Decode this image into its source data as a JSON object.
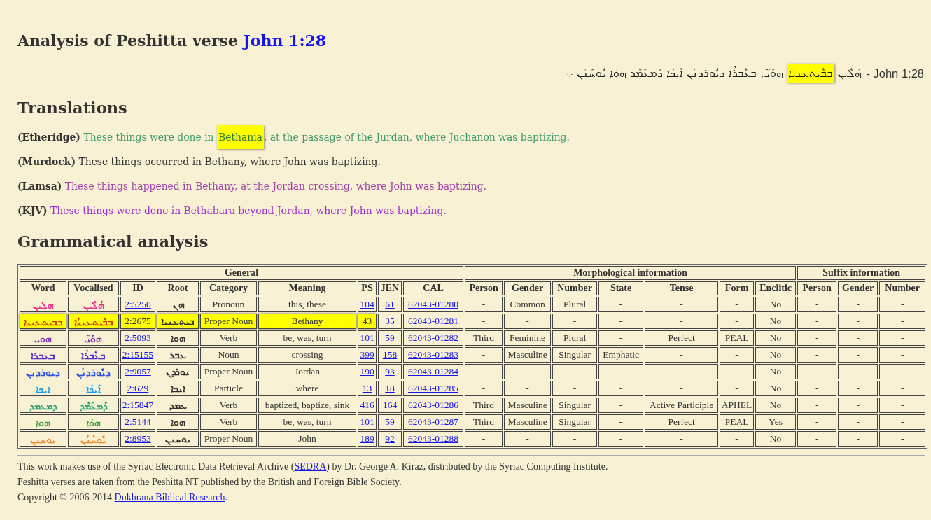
{
  "title": {
    "text": "Analysis of Peshitta verse",
    "link": "John 1:28"
  },
  "verse": {
    "segments": [
      {
        "text": "ܗܳܠܶܝܢ ",
        "highlighted": false
      },
      {
        "text": "ܒܒܶܝܬܥܢܝܳܐ",
        "highlighted": true
      },
      {
        "text": " ܗܘܰܝ̈, ܒܥܶܒܪܳܐ ܕܝܽܘܪܕܢܳܢ ܐܰܝܟܳܐ ܕܰܡܥܰܡܶܕ ܗܘܳܐ ܝܽܘܚܰܢܳܢ ܀",
        "highlighted": false
      }
    ],
    "reference": "- John 1:28"
  },
  "translations": {
    "heading": "Translations",
    "items": [
      {
        "translator": "(Etheridge)",
        "color": "#3d9b6e",
        "segments": [
          {
            "text": "These things were done in ",
            "highlighted": false
          },
          {
            "text": "Bethania",
            "highlighted": true
          },
          {
            "text": ", at the passage of the Jurdan, where Juchanon was baptizing.",
            "highlighted": false
          }
        ]
      },
      {
        "translator": "(Murdock)",
        "color": "#333333",
        "segments": [
          {
            "text": "These things occurred in Bethany, where John was baptizing.",
            "highlighted": false
          }
        ]
      },
      {
        "translator": "(Lamsa)",
        "color": "#a040a8",
        "segments": [
          {
            "text": "These things happened in Bethany, at the Jordan crossing, where John was baptizing.",
            "highlighted": false
          }
        ]
      },
      {
        "translator": "(KJV)",
        "color": "#a030d0",
        "segments": [
          {
            "text": "These things were done in Bethabara beyond Jordan, where John was baptizing.",
            "highlighted": false
          }
        ]
      }
    ]
  },
  "analysis": {
    "heading": "Grammatical analysis",
    "groups": [
      {
        "label": "General",
        "columns": [
          {
            "label": "Word",
            "kind": "colored-syriac"
          },
          {
            "label": "Vocalised",
            "kind": "colored-syriac"
          },
          {
            "label": "ID",
            "kind": "link"
          },
          {
            "label": "Root",
            "kind": "syriac"
          },
          {
            "label": "Category",
            "kind": "text"
          },
          {
            "label": "Meaning",
            "kind": "text"
          },
          {
            "label": "PS",
            "kind": "link"
          },
          {
            "label": "JEN",
            "kind": "link"
          },
          {
            "label": "CAL",
            "kind": "link"
          }
        ]
      },
      {
        "label": "Morphological information",
        "columns": [
          {
            "label": "Person",
            "kind": "text"
          },
          {
            "label": "Gender",
            "kind": "text"
          },
          {
            "label": "Number",
            "kind": "text"
          },
          {
            "label": "State",
            "kind": "text"
          },
          {
            "label": "Tense",
            "kind": "text"
          },
          {
            "label": "Form",
            "kind": "text"
          },
          {
            "label": "Enclitic",
            "kind": "text"
          }
        ]
      },
      {
        "label": "Suffix information",
        "columns": [
          {
            "label": "Person",
            "kind": "text"
          },
          {
            "label": "Gender",
            "kind": "text"
          },
          {
            "label": "Number",
            "kind": "text"
          }
        ]
      }
    ],
    "rows": [
      {
        "color": "#e8308a",
        "cells": [
          {
            "text": "ܗܠܝܢ",
            "highlighted": false
          },
          {
            "text": "ܗܳܠܶܝܢ",
            "highlighted": false
          },
          {
            "text": "2:5250",
            "highlighted": false
          },
          {
            "text": "ܗܢ",
            "highlighted": false
          },
          {
            "text": "Pronoun",
            "highlighted": false
          },
          {
            "text": "this, these",
            "highlighted": false
          },
          {
            "text": "104",
            "highlighted": false
          },
          {
            "text": "61",
            "highlighted": false
          },
          {
            "text": "62043-01280",
            "highlighted": false
          },
          {
            "text": "-",
            "highlighted": false
          },
          {
            "text": "Common",
            "highlighted": false
          },
          {
            "text": "Plural",
            "highlighted": false
          },
          {
            "text": "-",
            "highlighted": false
          },
          {
            "text": "-",
            "highlighted": false
          },
          {
            "text": "-",
            "highlighted": false
          },
          {
            "text": "No",
            "highlighted": false
          },
          {
            "text": "-",
            "highlighted": false
          },
          {
            "text": "-",
            "highlighted": false
          },
          {
            "text": "-",
            "highlighted": false
          }
        ]
      },
      {
        "color": "#c83a10",
        "cells": [
          {
            "text": "ܒܒܝܬܥܢܝܐ",
            "highlighted": true
          },
          {
            "text": "ܒܒܶܝܬܥܢܝܳܐ",
            "highlighted": true
          },
          {
            "text": "2:2675",
            "highlighted": true
          },
          {
            "text": "ܒܝܬܥܢܝܐ",
            "highlighted": true
          },
          {
            "text": "Proper Noun",
            "highlighted": true
          },
          {
            "text": "Bethany",
            "highlighted": true
          },
          {
            "text": "43",
            "highlighted": true
          },
          {
            "text": "35",
            "highlighted": false
          },
          {
            "text": "62043-01281",
            "highlighted": false
          },
          {
            "text": "-",
            "highlighted": false
          },
          {
            "text": "-",
            "highlighted": false
          },
          {
            "text": "-",
            "highlighted": false
          },
          {
            "text": "-",
            "highlighted": false
          },
          {
            "text": "-",
            "highlighted": false
          },
          {
            "text": "-",
            "highlighted": false
          },
          {
            "text": "No",
            "highlighted": false
          },
          {
            "text": "-",
            "highlighted": false
          },
          {
            "text": "-",
            "highlighted": false
          },
          {
            "text": "-",
            "highlighted": false
          }
        ]
      },
      {
        "color": "#7a30a8",
        "cells": [
          {
            "text": "ܗܘܝ",
            "highlighted": false
          },
          {
            "text": "ܗܘܰܝ̈",
            "highlighted": false
          },
          {
            "text": "2:5093",
            "highlighted": false
          },
          {
            "text": "ܗܘܐ",
            "highlighted": false
          },
          {
            "text": "Verb",
            "highlighted": false
          },
          {
            "text": "be, was, turn",
            "highlighted": false
          },
          {
            "text": "101",
            "highlighted": false
          },
          {
            "text": "59",
            "highlighted": false
          },
          {
            "text": "62043-01282",
            "highlighted": false
          },
          {
            "text": "Third",
            "highlighted": false
          },
          {
            "text": "Feminine",
            "highlighted": false
          },
          {
            "text": "Plural",
            "highlighted": false
          },
          {
            "text": "-",
            "highlighted": false
          },
          {
            "text": "Perfect",
            "highlighted": false
          },
          {
            "text": "PEAL",
            "highlighted": false
          },
          {
            "text": "No",
            "highlighted": false
          },
          {
            "text": "-",
            "highlighted": false
          },
          {
            "text": "-",
            "highlighted": false
          },
          {
            "text": "-",
            "highlighted": false
          }
        ]
      },
      {
        "color": "#5a30c8",
        "cells": [
          {
            "text": "ܒܥܒܪܐ",
            "highlighted": false
          },
          {
            "text": "ܒܥܶܒܪܳܐ",
            "highlighted": false
          },
          {
            "text": "2:15155",
            "highlighted": false
          },
          {
            "text": "ܥܒܪ",
            "highlighted": false
          },
          {
            "text": "Noun",
            "highlighted": false
          },
          {
            "text": "crossing",
            "highlighted": false
          },
          {
            "text": "399",
            "highlighted": false
          },
          {
            "text": "158",
            "highlighted": false
          },
          {
            "text": "62043-01283",
            "highlighted": false
          },
          {
            "text": "-",
            "highlighted": false
          },
          {
            "text": "Masculine",
            "highlighted": false
          },
          {
            "text": "Singular",
            "highlighted": false
          },
          {
            "text": "Emphatic",
            "highlighted": false
          },
          {
            "text": "-",
            "highlighted": false
          },
          {
            "text": "-",
            "highlighted": false
          },
          {
            "text": "No",
            "highlighted": false
          },
          {
            "text": "-",
            "highlighted": false
          },
          {
            "text": "-",
            "highlighted": false
          },
          {
            "text": "-",
            "highlighted": false
          }
        ]
      },
      {
        "color": "#2a50e0",
        "cells": [
          {
            "text": "ܕܝܘܪܕܢܢ",
            "highlighted": false
          },
          {
            "text": "ܕܝܽܘܪܕܢܳܢ",
            "highlighted": false
          },
          {
            "text": "2:9057",
            "highlighted": false
          },
          {
            "text": "ܝܘܪܕܢ",
            "highlighted": false
          },
          {
            "text": "Proper Noun",
            "highlighted": false
          },
          {
            "text": "Jordan",
            "highlighted": false
          },
          {
            "text": "190",
            "highlighted": false
          },
          {
            "text": "93",
            "highlighted": false
          },
          {
            "text": "62043-01284",
            "highlighted": false
          },
          {
            "text": "-",
            "highlighted": false
          },
          {
            "text": "-",
            "highlighted": false
          },
          {
            "text": "-",
            "highlighted": false
          },
          {
            "text": "-",
            "highlighted": false
          },
          {
            "text": "-",
            "highlighted": false
          },
          {
            "text": "-",
            "highlighted": false
          },
          {
            "text": "No",
            "highlighted": false
          },
          {
            "text": "-",
            "highlighted": false
          },
          {
            "text": "-",
            "highlighted": false
          },
          {
            "text": "-",
            "highlighted": false
          }
        ]
      },
      {
        "color": "#18a0f0",
        "cells": [
          {
            "text": "ܐܝܟܐ",
            "highlighted": false
          },
          {
            "text": "ܐܰܝܟܳܐ",
            "highlighted": false
          },
          {
            "text": "2:629",
            "highlighted": false
          },
          {
            "text": "ܐܝܟܐ",
            "highlighted": false
          },
          {
            "text": "Particle",
            "highlighted": false
          },
          {
            "text": "where",
            "highlighted": false
          },
          {
            "text": "13",
            "highlighted": false
          },
          {
            "text": "18",
            "highlighted": false
          },
          {
            "text": "62043-01285",
            "highlighted": false
          },
          {
            "text": "-",
            "highlighted": false
          },
          {
            "text": "-",
            "highlighted": false
          },
          {
            "text": "-",
            "highlighted": false
          },
          {
            "text": "-",
            "highlighted": false
          },
          {
            "text": "-",
            "highlighted": false
          },
          {
            "text": "-",
            "highlighted": false
          },
          {
            "text": "No",
            "highlighted": false
          },
          {
            "text": "-",
            "highlighted": false
          },
          {
            "text": "-",
            "highlighted": false
          },
          {
            "text": "-",
            "highlighted": false
          }
        ]
      },
      {
        "color": "#20a070",
        "cells": [
          {
            "text": "ܕܡܥܡܕ",
            "highlighted": false
          },
          {
            "text": "ܕܰܡܥܰܡܶܕ",
            "highlighted": false
          },
          {
            "text": "2:15847",
            "highlighted": false
          },
          {
            "text": "ܥܡܕ",
            "highlighted": false
          },
          {
            "text": "Verb",
            "highlighted": false
          },
          {
            "text": "baptized, baptize, sink",
            "highlighted": false
          },
          {
            "text": "416",
            "highlighted": false
          },
          {
            "text": "164",
            "highlighted": false
          },
          {
            "text": "62043-01286",
            "highlighted": false
          },
          {
            "text": "Third",
            "highlighted": false
          },
          {
            "text": "Masculine",
            "highlighted": false
          },
          {
            "text": "Singular",
            "highlighted": false
          },
          {
            "text": "-",
            "highlighted": false
          },
          {
            "text": "Active Participle",
            "highlighted": false
          },
          {
            "text": "APHEL",
            "highlighted": false
          },
          {
            "text": "No",
            "highlighted": false
          },
          {
            "text": "-",
            "highlighted": false
          },
          {
            "text": "-",
            "highlighted": false
          },
          {
            "text": "-",
            "highlighted": false
          }
        ]
      },
      {
        "color": "#40a040",
        "cells": [
          {
            "text": "ܗܘܐ",
            "highlighted": false
          },
          {
            "text": "ܗܘܳܐ",
            "highlighted": false
          },
          {
            "text": "2:5144",
            "highlighted": false
          },
          {
            "text": "ܗܘܐ",
            "highlighted": false
          },
          {
            "text": "Verb",
            "highlighted": false
          },
          {
            "text": "be, was, turn",
            "highlighted": false
          },
          {
            "text": "101",
            "highlighted": false
          },
          {
            "text": "59",
            "highlighted": false
          },
          {
            "text": "62043-01287",
            "highlighted": false
          },
          {
            "text": "Third",
            "highlighted": false
          },
          {
            "text": "Masculine",
            "highlighted": false
          },
          {
            "text": "Singular",
            "highlighted": false
          },
          {
            "text": "-",
            "highlighted": false
          },
          {
            "text": "Perfect",
            "highlighted": false
          },
          {
            "text": "PEAL",
            "highlighted": false
          },
          {
            "text": "Yes",
            "highlighted": false
          },
          {
            "text": "-",
            "highlighted": false
          },
          {
            "text": "-",
            "highlighted": false
          },
          {
            "text": "-",
            "highlighted": false
          }
        ]
      },
      {
        "color": "#f08a30",
        "cells": [
          {
            "text": "ܝܘܚܢܢ",
            "highlighted": false
          },
          {
            "text": "ܝܽܘܚܰܢܳܢ",
            "highlighted": false
          },
          {
            "text": "2:8953",
            "highlighted": false
          },
          {
            "text": "ܝܘܚܢܢ",
            "highlighted": false
          },
          {
            "text": "Proper Noun",
            "highlighted": false
          },
          {
            "text": "John",
            "highlighted": false
          },
          {
            "text": "189",
            "highlighted": false
          },
          {
            "text": "92",
            "highlighted": false
          },
          {
            "text": "62043-01288",
            "highlighted": false
          },
          {
            "text": "-",
            "highlighted": false
          },
          {
            "text": "-",
            "highlighted": false
          },
          {
            "text": "-",
            "highlighted": false
          },
          {
            "text": "-",
            "highlighted": false
          },
          {
            "text": "-",
            "highlighted": false
          },
          {
            "text": "-",
            "highlighted": false
          },
          {
            "text": "No",
            "highlighted": false
          },
          {
            "text": "-",
            "highlighted": false
          },
          {
            "text": "-",
            "highlighted": false
          },
          {
            "text": "-",
            "highlighted": false
          }
        ]
      }
    ]
  },
  "footer": {
    "lines": [
      {
        "parts": [
          {
            "kind": "text",
            "text": "This work makes use of the Syriac Electronic Data Retrieval Archive ("
          },
          {
            "kind": "link",
            "text": "SEDRA"
          },
          {
            "kind": "text",
            "text": ") by Dr. George A. Kiraz, distributed by the Syriac Computing Institute."
          }
        ]
      },
      {
        "parts": [
          {
            "kind": "text",
            "text": "Peshitta verses are taken from the Peshitta NT published by the British and Foreign Bible Society."
          }
        ]
      },
      {
        "parts": [
          {
            "kind": "text",
            "text": "Copyright © 2006-2014 "
          },
          {
            "kind": "link",
            "text": "Dukhrana Biblical Research"
          },
          {
            "kind": "text",
            "text": "."
          }
        ]
      }
    ]
  }
}
